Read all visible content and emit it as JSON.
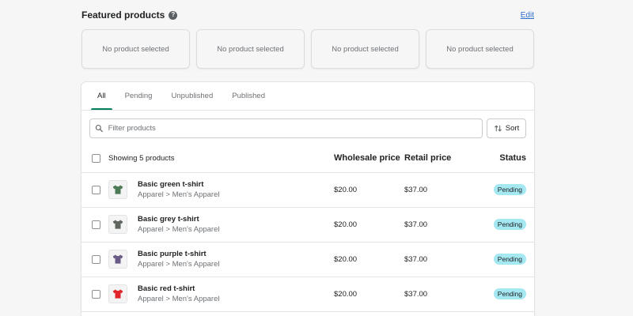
{
  "featured": {
    "title": "Featured products",
    "help_icon": "?",
    "edit_label": "Edit",
    "slots": [
      "No product selected",
      "No product selected",
      "No product selected",
      "No product selected"
    ]
  },
  "tabs": [
    {
      "label": "All",
      "active": true
    },
    {
      "label": "Pending",
      "active": false
    },
    {
      "label": "Unpublished",
      "active": false
    },
    {
      "label": "Published",
      "active": false
    }
  ],
  "filter": {
    "placeholder": "Filter products",
    "sort_label": "Sort",
    "search_icon": "search-icon",
    "sort_icon": "sort-arrows-icon"
  },
  "table": {
    "showing_label": "Showing 5 products",
    "headers": {
      "wholesale": "Wholesale price",
      "retail": "Retail price",
      "status": "Status"
    },
    "rows": [
      {
        "name": "Basic green t-shirt",
        "category": "Apparel > Men's Apparel",
        "wholesale": "$20.00",
        "retail": "$37.00",
        "status": "Pending",
        "shirt_color": "#4c7a57"
      },
      {
        "name": "Basic grey t-shirt",
        "category": "Apparel > Men's Apparel",
        "wholesale": "$20.00",
        "retail": "$37.00",
        "status": "Pending",
        "shirt_color": "#5f6760"
      },
      {
        "name": "Basic purple t-shirt",
        "category": "Apparel > Men's Apparel",
        "wholesale": "$20.00",
        "retail": "$37.00",
        "status": "Pending",
        "shirt_color": "#6a5a86"
      },
      {
        "name": "Basic red t-shirt",
        "category": "Apparel > Men's Apparel",
        "wholesale": "$20.00",
        "retail": "$37.00",
        "status": "Pending",
        "shirt_color": "#e0262b"
      }
    ]
  },
  "colors": {
    "accent": "#008060",
    "link": "#2c6ecb",
    "badge": "#a4e8f2"
  }
}
